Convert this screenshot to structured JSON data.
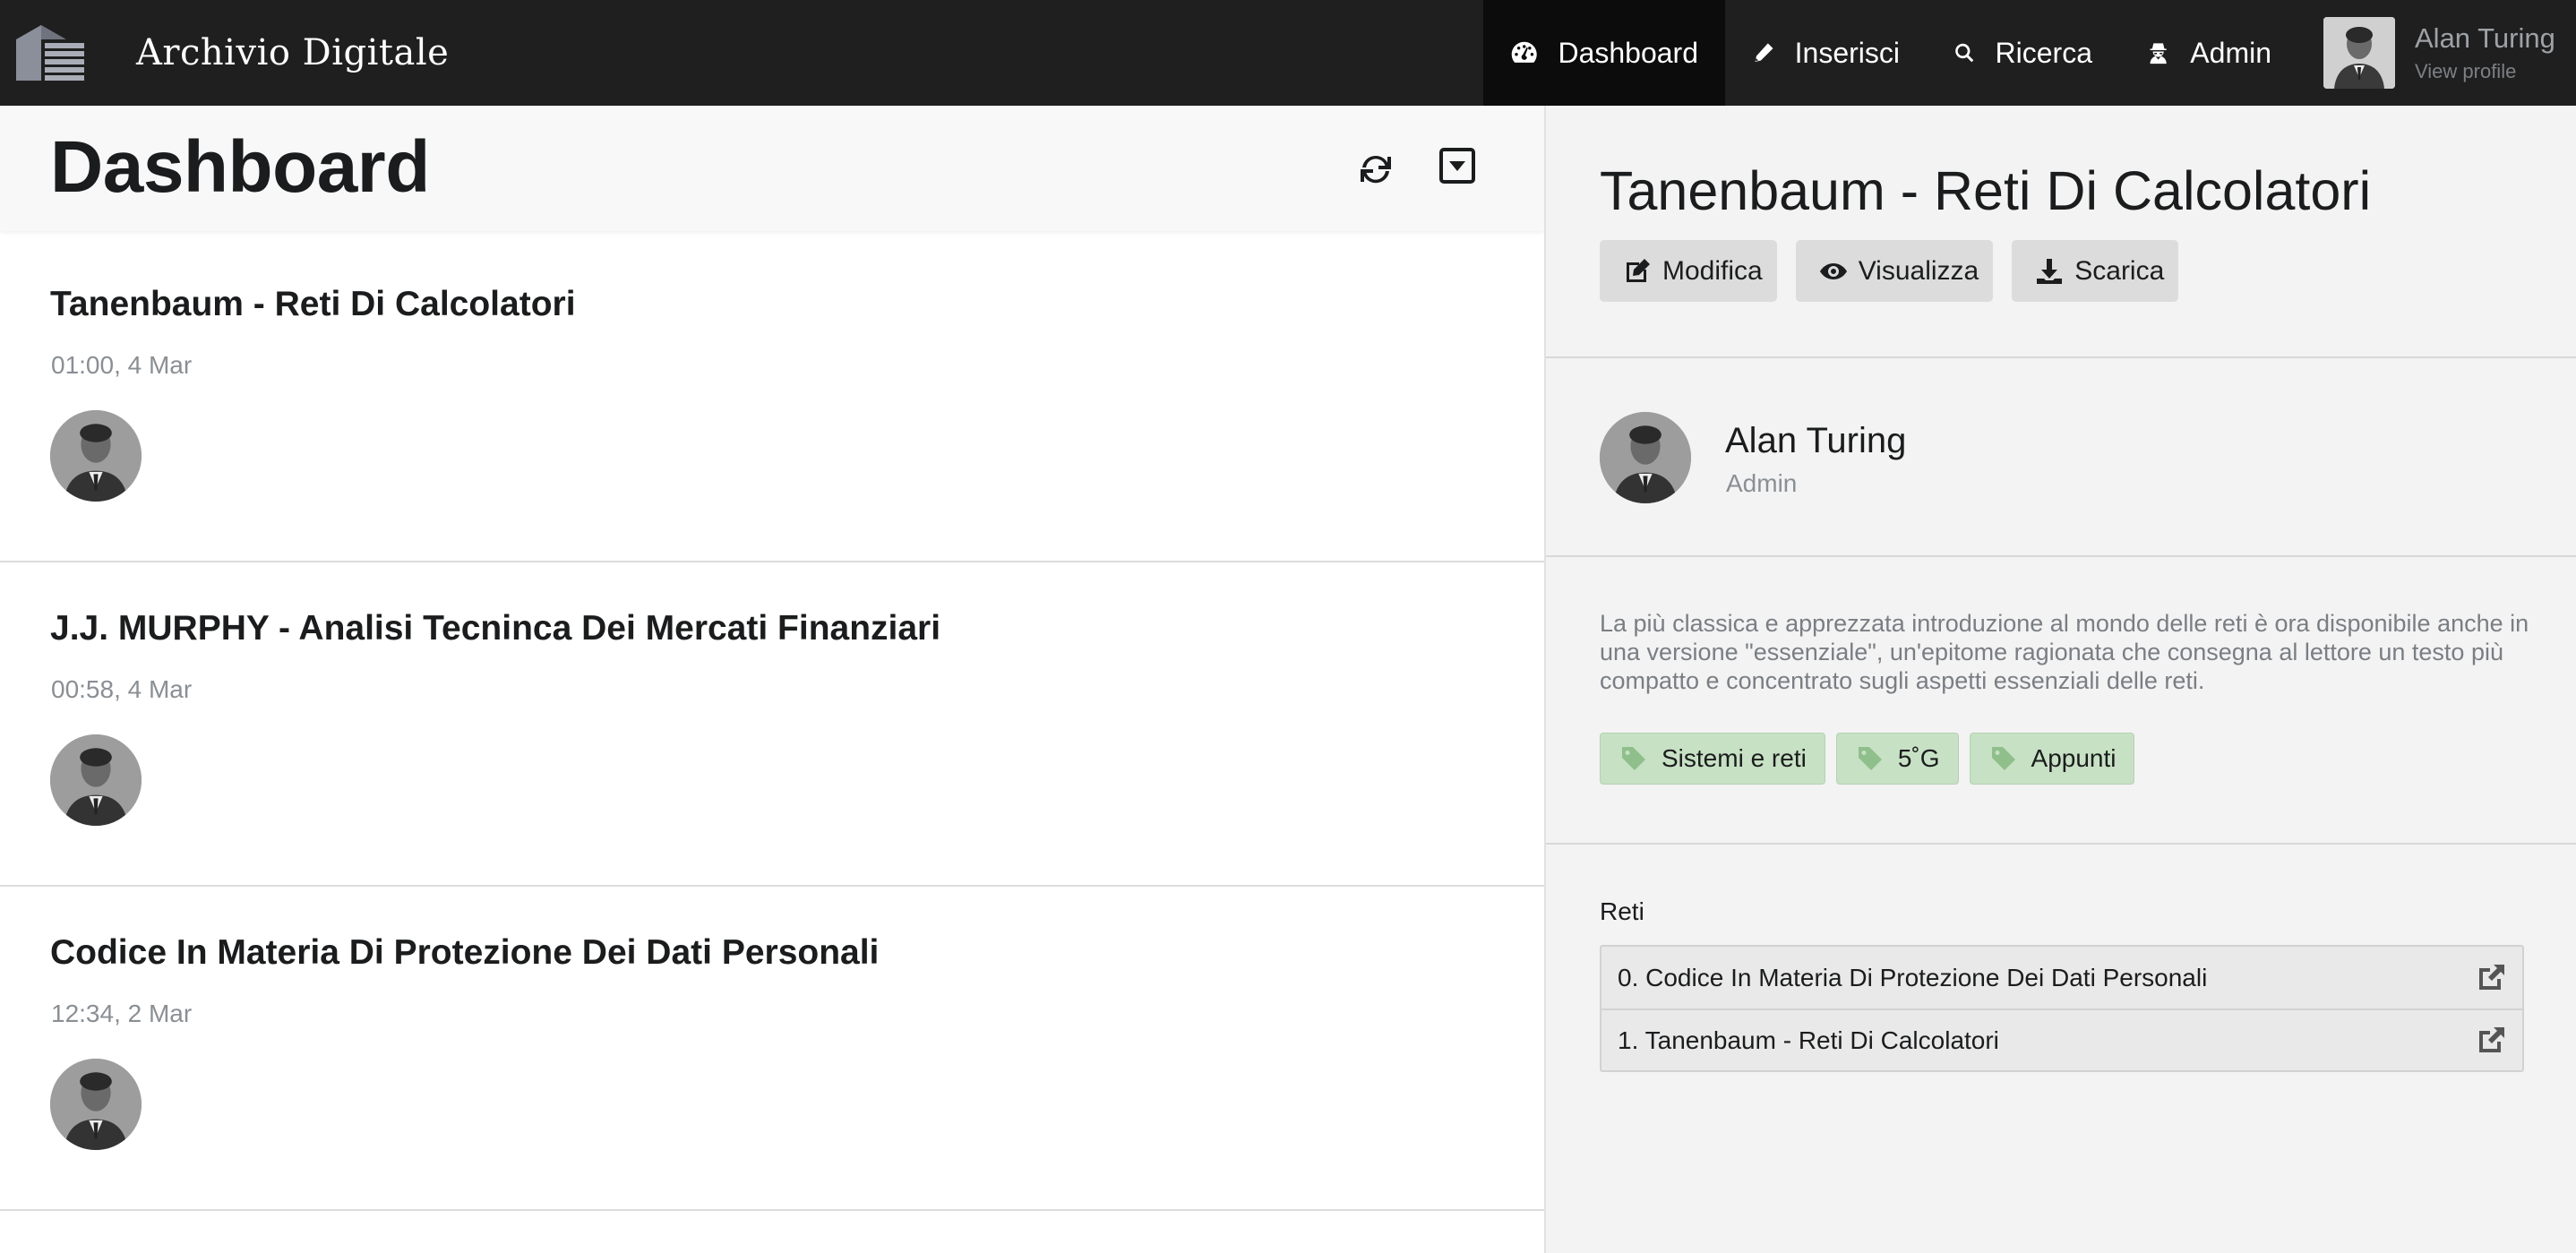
{
  "app": {
    "title": "Archivio Digitale"
  },
  "nav": {
    "items": [
      {
        "label": "Dashboard",
        "icon": "dashboard-icon",
        "active": true
      },
      {
        "label": "Inserisci",
        "icon": "pencil-icon",
        "active": false
      },
      {
        "label": "Ricerca",
        "icon": "search-icon",
        "active": false
      },
      {
        "label": "Admin",
        "icon": "user-secret-icon",
        "active": false
      }
    ]
  },
  "profile": {
    "name": "Alan Turing",
    "link": "View profile"
  },
  "dashboard": {
    "title": "Dashboard",
    "items": [
      {
        "title": "Tanenbaum - Reti Di Calcolatori",
        "date": "01:00, 4 Mar"
      },
      {
        "title": "J.J. MURPHY - Analisi Tecninca Dei Mercati Finanziari",
        "date": "00:58, 4 Mar"
      },
      {
        "title": "Codice In Materia Di Protezione Dei Dati Personali",
        "date": "12:34, 2 Mar"
      }
    ]
  },
  "detail": {
    "title": "Tanenbaum - Reti Di Calcolatori",
    "buttons": {
      "edit": "Modifica",
      "view": "Visualizza",
      "download": "Scarica"
    },
    "author": {
      "name": "Alan Turing",
      "role": "Admin"
    },
    "description": "La più classica e apprezzata introduzione al mondo delle reti è ora disponibile anche in una versione \"essenziale\", un'epitome ragionata che consegna al lettore un testo più compatto e concentrato sugli aspetti essenziali delle reti.",
    "tags": [
      "Sistemi e reti",
      "5˚G",
      "Appunti"
    ],
    "collection": {
      "label": "Reti",
      "items": [
        "0. Codice In Materia Di Protezione Dei Dati Personali",
        "1. Tanenbaum - Reti Di Calcolatori"
      ]
    }
  },
  "colors": {
    "topbar": "#1f1f1f",
    "active_nav": "#0c0c0c",
    "panel_bg": "#f3f3f3",
    "tag_bg": "#c7e1c4",
    "button_bg": "#dcdcdc"
  }
}
